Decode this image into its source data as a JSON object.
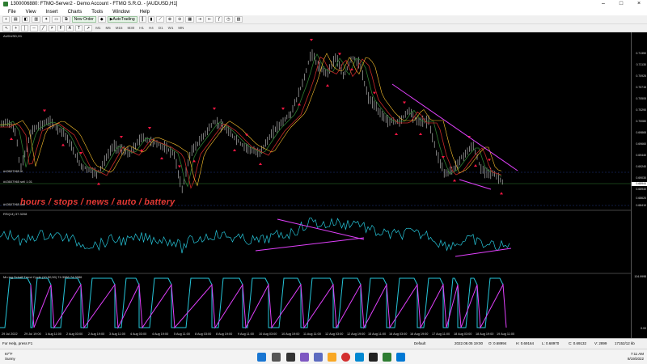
{
  "window": {
    "title": "1300006880: FTMO-Server2 - Demo Account - FTMO S.R.O. - [AUDUSD,H1]"
  },
  "menu": [
    "File",
    "View",
    "Insert",
    "Charts",
    "Tools",
    "Window",
    "Help"
  ],
  "toolbar": {
    "new_order": "New Order",
    "autotrading": "AutoTrading",
    "timeframes": [
      "M1",
      "M5",
      "M15",
      "M30",
      "H1",
      "H4",
      "D1",
      "W1",
      "MN"
    ]
  },
  "chart": {
    "symbol_label": "AUDUSD,H1",
    "order_label_1": "#43607965 sl",
    "order_label_2": "#43607965 sell 1.01",
    "order_label_3": "#43607965 sell",
    "overlay": "hours / stops / news / auto / battery",
    "rsi_label": "RSI(14) 37.3208",
    "schaff_label": "Mn lag Schaff Trend Cycle (10,50,50) 74.3986 74.3986",
    "price_ticks": [
      "0.71350",
      "0.71130",
      "0.70925",
      "0.70715",
      "0.70505",
      "0.70290",
      "0.70080",
      "0.69865",
      "0.69660",
      "0.69440",
      "0.69240",
      "0.69030",
      "0.68940",
      "0.68620",
      "0.68410"
    ],
    "current_price": "0.68944",
    "schaff_scale_top": "104.9998",
    "schaff_scale_bottom": "0.00",
    "time_labels": [
      "29 Jul 2022",
      "29 Jul 19:00",
      "1 Aug 11:00",
      "2 Aug 03:00",
      "2 Aug 19:00",
      "3 Aug 11:00",
      "4 Aug 03:00",
      "4 Aug 19:00",
      "5 Aug 11:00",
      "8 Aug 03:00",
      "8 Aug 19:00",
      "9 Aug 11:00",
      "10 Aug 03:00",
      "10 Aug 19:00",
      "11 Aug 11:00",
      "12 Aug 03:00",
      "12 Aug 19:00",
      "15 Aug 11:00",
      "16 Aug 03:00",
      "16 Aug 19:00",
      "17 Aug 11:00",
      "18 Aug 03:00",
      "18 Aug 19:00",
      "19 Aug 11:00"
    ]
  },
  "status": {
    "help": "For Help, press F1",
    "profile": "Default",
    "datetime": "2022.08.05 19:00",
    "open": "O: 0.68994",
    "high": "H: 0.69164",
    "low": "L: 0.68970",
    "close": "C: 0.69132",
    "volume": "V: 2899",
    "traffic": "17152/12 kb"
  },
  "taskbar": {
    "temp": "67°F",
    "weather": "Sunny",
    "time": "7:11 AM",
    "date": "8/19/2022"
  },
  "colors": {
    "background": "#000000",
    "rsi_line": "#26c6da",
    "trend_line": "#e040fb",
    "arrows": "#ff1744",
    "overlay_text": "#e53935"
  }
}
